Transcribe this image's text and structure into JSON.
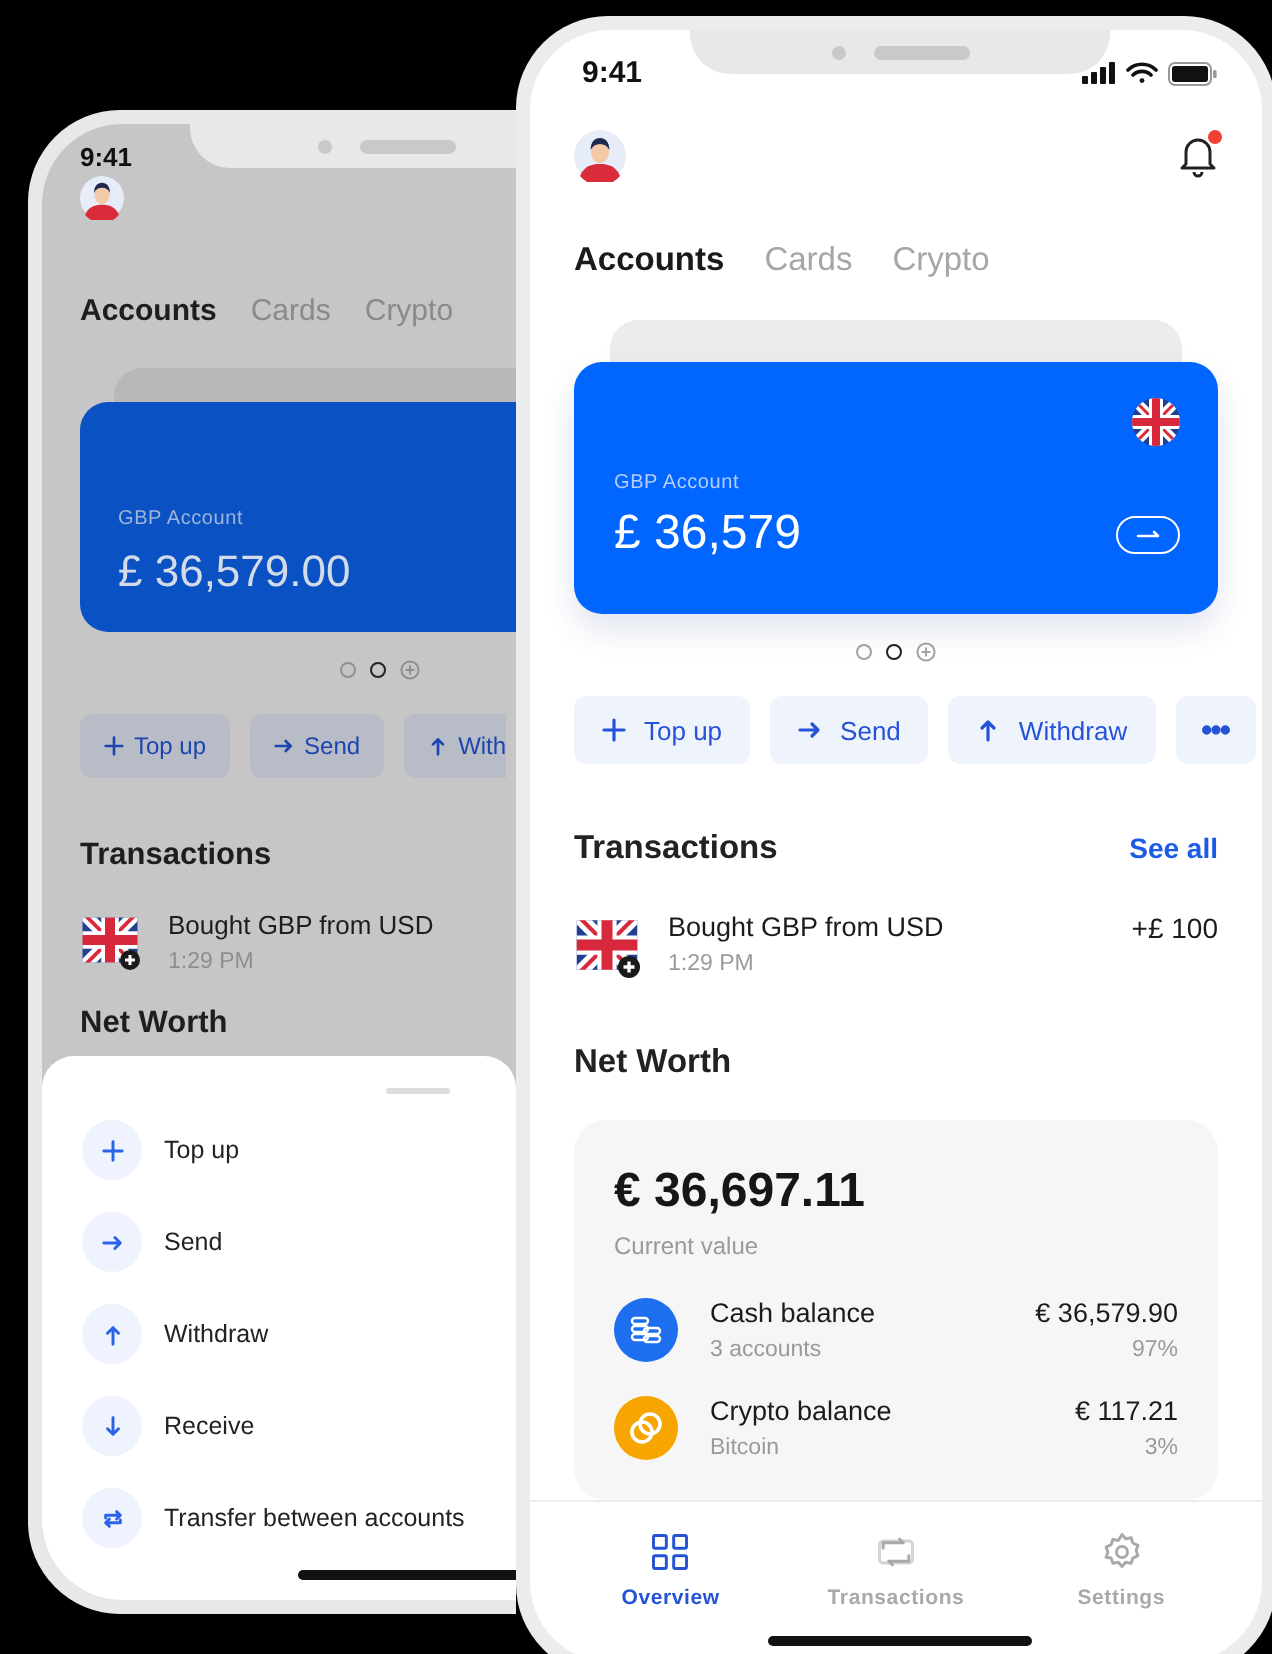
{
  "back_phone": {
    "time": "9:41",
    "tabs": [
      {
        "label": "Accounts",
        "selected": true
      },
      {
        "label": "Cards",
        "selected": false
      },
      {
        "label": "Crypto",
        "selected": false
      }
    ],
    "account_card": {
      "label": "GBP Account",
      "balance": "£ 36,579.00"
    },
    "pager": [
      {
        "kind": "dot",
        "selected": false
      },
      {
        "kind": "dot",
        "selected": true
      },
      {
        "kind": "add",
        "selected": false
      }
    ],
    "actions": [
      {
        "kind": "plus",
        "label": "Top up"
      },
      {
        "kind": "send",
        "label": "Send"
      },
      {
        "kind": "up",
        "label": "With"
      }
    ],
    "transactions": {
      "title": "Transactions",
      "items": [
        {
          "title": "Bought GBP from USD",
          "time": "1:29 PM"
        }
      ]
    },
    "net_worth": {
      "title": "Net Worth"
    },
    "action_sheet": {
      "items": [
        {
          "kind": "plus",
          "label": "Top up"
        },
        {
          "kind": "send",
          "label": "Send"
        },
        {
          "kind": "up",
          "label": "Withdraw"
        },
        {
          "kind": "down",
          "label": "Receive"
        },
        {
          "kind": "transfer",
          "label": "Transfer between accounts"
        }
      ]
    }
  },
  "front_phone": {
    "time": "9:41",
    "has_notification": true,
    "tabs": [
      {
        "label": "Accounts",
        "selected": true
      },
      {
        "label": "Cards",
        "selected": false
      },
      {
        "label": "Crypto",
        "selected": false
      }
    ],
    "account_card": {
      "label": "GBP Account",
      "balance": "£ 36,579"
    },
    "pager": [
      {
        "kind": "dot",
        "selected": false
      },
      {
        "kind": "dot",
        "selected": true
      },
      {
        "kind": "add",
        "selected": false
      }
    ],
    "actions": [
      {
        "kind": "plus",
        "label": "Top up"
      },
      {
        "kind": "send",
        "label": "Send"
      },
      {
        "kind": "up",
        "label": "Withdraw"
      },
      {
        "kind": "more"
      }
    ],
    "transactions": {
      "title": "Transactions",
      "link": "See all",
      "items": [
        {
          "title": "Bought GBP from USD",
          "time": "1:29 PM",
          "amount": "+£ 100"
        }
      ]
    },
    "net_worth": {
      "title": "Net Worth",
      "total": "€ 36,697.11",
      "caption": "Current value",
      "items": [
        {
          "kind": "cash",
          "name": "Cash balance",
          "detail": "3 accounts",
          "amount": "€ 36,579.90",
          "share": "97%"
        },
        {
          "kind": "crypto",
          "name": "Crypto balance",
          "detail": "Bitcoin",
          "amount": "€ 117.21",
          "share": "3%"
        }
      ]
    },
    "nav": [
      {
        "kind": "overview",
        "label": "Overview",
        "selected": true
      },
      {
        "kind": "transfer",
        "label": "Transactions",
        "selected": false
      },
      {
        "kind": "settings",
        "label": "Settings",
        "selected": false
      }
    ]
  }
}
